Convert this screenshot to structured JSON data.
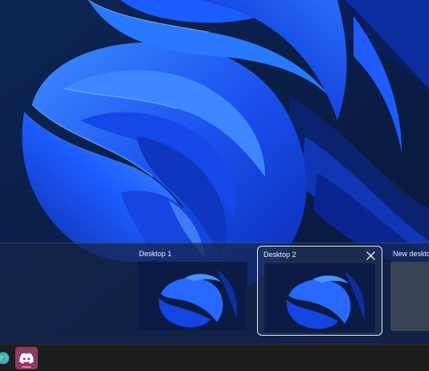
{
  "desktop_flyout": {
    "desktops": [
      {
        "label": "Desktop 1",
        "active": false
      },
      {
        "label": "Desktop 2",
        "active": true
      },
      {
        "label": "New desktop",
        "active": false
      }
    ],
    "close_icon": "close-icon"
  },
  "taskbar": {
    "apps": [
      {
        "icon": "app-globe-icon"
      },
      {
        "icon": "discord-icon",
        "active": true
      }
    ]
  },
  "colors": {
    "wallpaper_blue": "#1a4fe8",
    "taskbar_bg": "#1d1d1f",
    "active_app_bg": "#8d3a66",
    "active_indicator": "#f472a8",
    "selected_border": "#e6e9ee"
  }
}
